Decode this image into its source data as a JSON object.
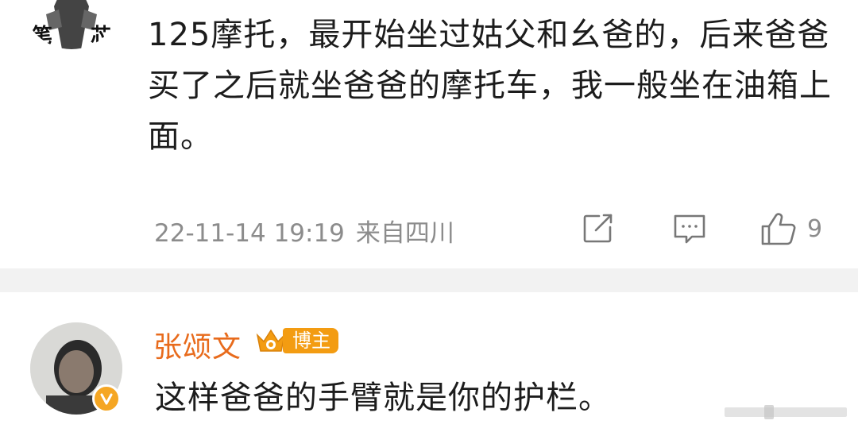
{
  "comment": {
    "avatar_text": [
      "笔",
      "芯"
    ],
    "text": "125摩托，最开始坐过姑父和幺爸的，后来爸爸买了之后就坐爸爸的摩托车，我一般坐在油箱上面。",
    "timestamp": "22-11-14 19:19",
    "location": "来自四川",
    "like_count": "9",
    "icons": [
      "repost-icon",
      "comment-icon",
      "like-icon"
    ]
  },
  "reply": {
    "username": "张颂文",
    "badge_label": "博主",
    "text": "这样爸爸的手臂就是你的护栏。",
    "avatar_icon": "verified-v-icon"
  },
  "colors": {
    "username": "#e86b1c",
    "badge": "#f39c12",
    "meta_text": "#8c8c8c",
    "divider": "#f2f2f2",
    "verify": "#f5a623"
  }
}
